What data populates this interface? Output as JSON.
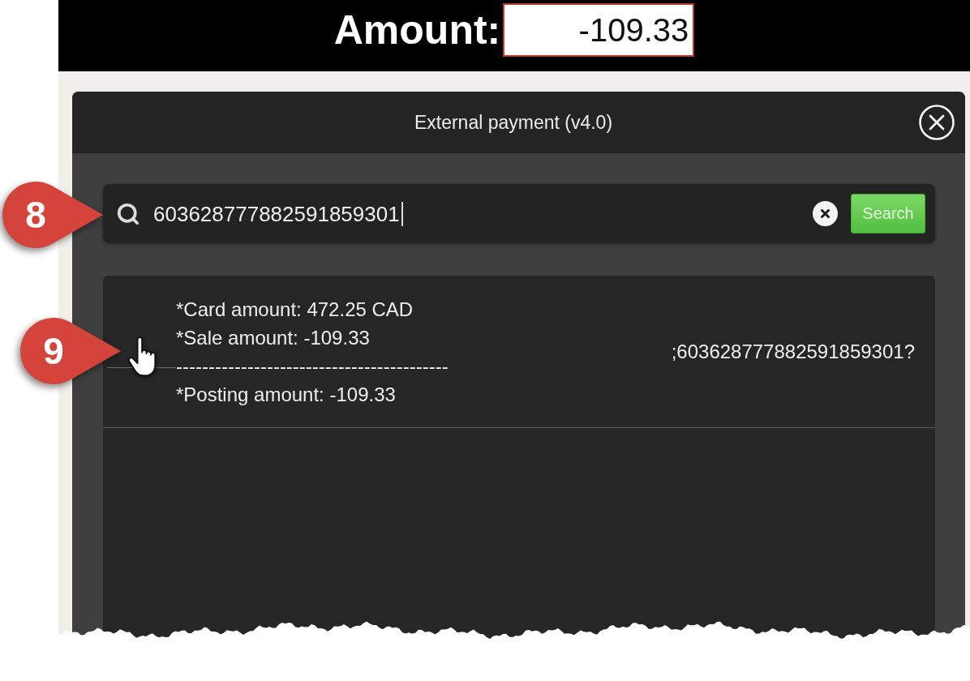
{
  "header": {
    "label": "Amount:",
    "amount": "-109.33"
  },
  "dialog": {
    "title": "External payment (v4.0)",
    "search": {
      "value": "603628777882591859301",
      "button": "Search"
    },
    "results": [
      {
        "details": [
          "*Card amount: 472.25 CAD",
          "*Sale amount: -109.33",
          "------------------------------------------",
          "*Posting amount: -109.33"
        ],
        "card_data": ";603628777882591859301?"
      }
    ]
  },
  "callouts": [
    "8",
    "9"
  ]
}
